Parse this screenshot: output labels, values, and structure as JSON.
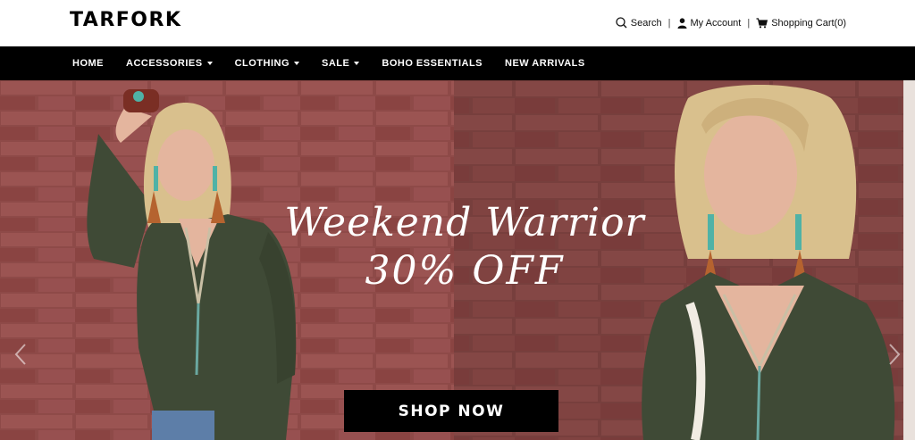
{
  "header": {
    "logo": "TARFORK",
    "search_label": "Search",
    "account_label": "My Account",
    "cart_label": "Shopping Cart(0)",
    "separator": "|"
  },
  "nav": {
    "items": [
      {
        "label": "HOME",
        "dropdown": false
      },
      {
        "label": "ACCESSORIES",
        "dropdown": true
      },
      {
        "label": "CLOTHING",
        "dropdown": true
      },
      {
        "label": "SALE",
        "dropdown": true
      },
      {
        "label": "BOHO ESSENTIALS",
        "dropdown": false
      },
      {
        "label": "NEW ARRIVALS",
        "dropdown": false
      }
    ]
  },
  "hero": {
    "headline_line1": "Weekend Warrior",
    "headline_line2": "30% OFF",
    "cta_label": "SHOP NOW",
    "icons": [
      "chevron-left-icon",
      "chevron-right-icon"
    ]
  },
  "colors": {
    "nav_bg": "#000000",
    "brick": "#8a4646",
    "shirt": "#3f4a36",
    "hair": "#d9c08d",
    "skin": "#e4b59e"
  }
}
